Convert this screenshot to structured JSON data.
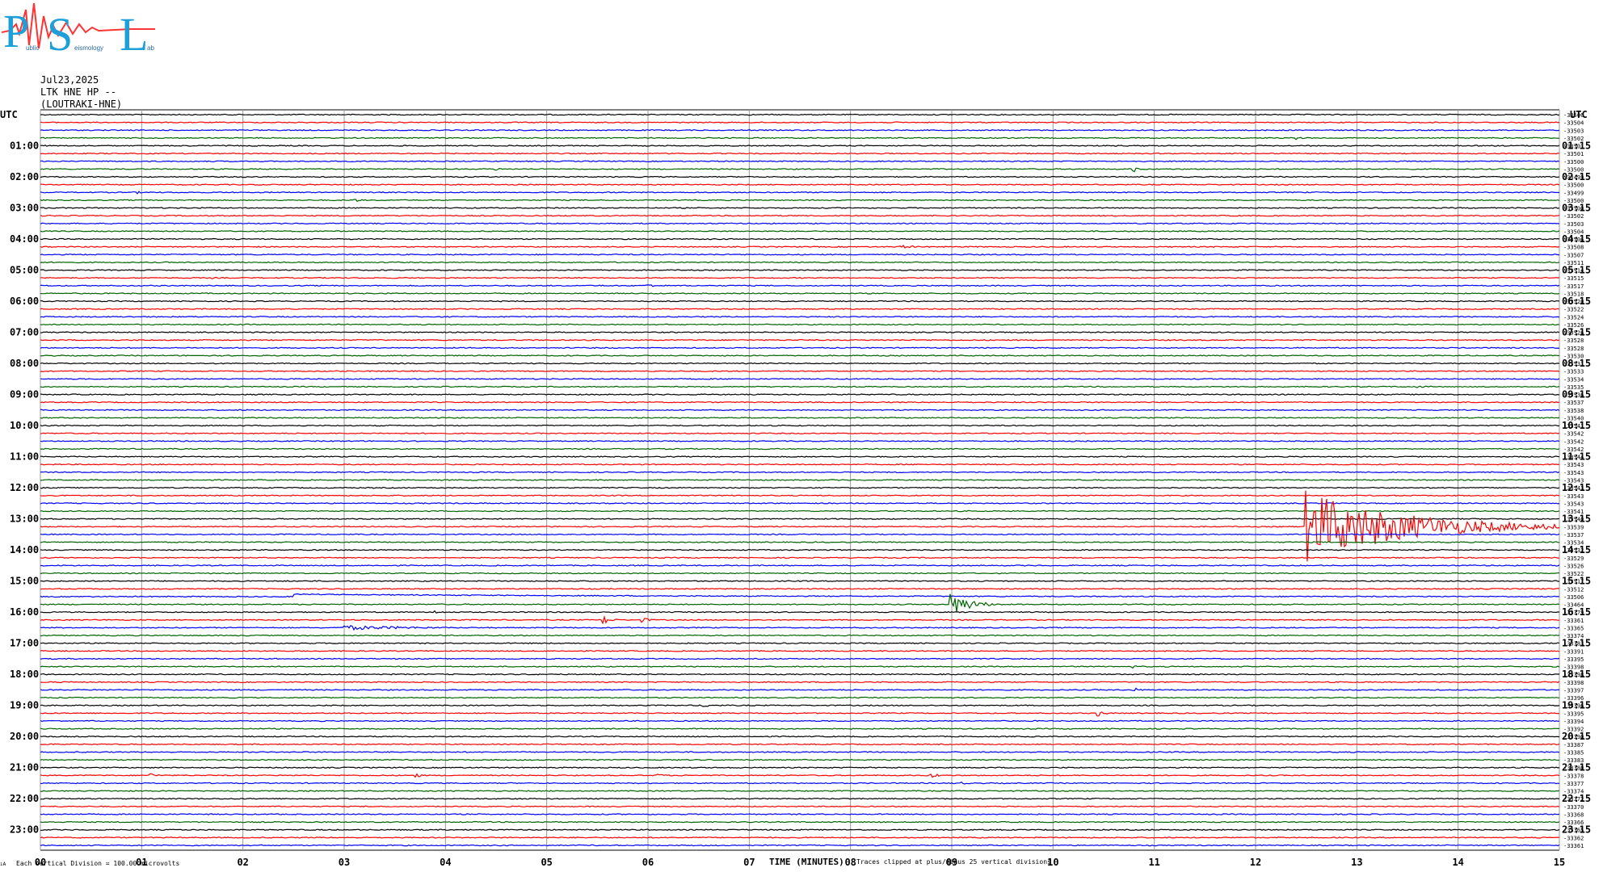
{
  "logo": {
    "letters": [
      "P",
      "S",
      "L"
    ],
    "words": [
      "ublic",
      "eismology",
      "ab"
    ],
    "colors": {
      "letters": "#1e9fd8",
      "wave": "#ff3333",
      "text": "#2a6aa0"
    }
  },
  "header": {
    "date": "Jul23,2025",
    "station": "LTK HNE HP --",
    "site": "(LOUTRAKI-HNE)"
  },
  "footer": {
    "scale_note": "Each Vertical Division =  100.00 microvolts",
    "clip_note": "Traces clipped at plus/minus 25 vertical divisions",
    "corner_mark": "ıA"
  },
  "chart_data": {
    "type": "line",
    "title": "",
    "xlabel": "TIME (MINUTES)",
    "ylabel": "",
    "xlim": [
      0,
      15
    ],
    "x_ticks": [
      "00",
      "01",
      "02",
      "03",
      "04",
      "05",
      "06",
      "07",
      "08",
      "09",
      "10",
      "11",
      "12",
      "13",
      "14",
      "15"
    ],
    "grid": true,
    "rows_per_hour": 4,
    "trace_colors": [
      "#000000",
      "#ff0000",
      "#0000ff",
      "#006400"
    ],
    "left_label_header": "UTC",
    "right_label_header": "UTC",
    "left_hour_labels": [
      "01:00",
      "02:00",
      "03:00",
      "04:00",
      "05:00",
      "06:00",
      "07:00",
      "08:00",
      "09:00",
      "10:00",
      "11:00",
      "12:00",
      "13:00",
      "14:00",
      "15:00",
      "16:00",
      "17:00",
      "18:00",
      "19:00",
      "20:00",
      "21:00",
      "22:00",
      "23:00"
    ],
    "right_hour_labels": [
      "01:15",
      "02:15",
      "03:15",
      "04:15",
      "05:15",
      "06:15",
      "07:15",
      "08:15",
      "09:15",
      "10:15",
      "11:15",
      "12:15",
      "13:15",
      "14:15",
      "15:15",
      "16:15",
      "17:15",
      "18:15",
      "19:15",
      "20:15",
      "21:15",
      "22:15",
      "23:15"
    ],
    "trace_offsets": [
      "-33506",
      "-33504",
      "-33503",
      "-33502",
      "-33501",
      "-33501",
      "-33500",
      "-33500",
      "-33499",
      "-33500",
      "-33499",
      "-33500",
      "-33500",
      "-33502",
      "-33503",
      "-33504",
      "-33506",
      "-33508",
      "-33507",
      "-33511",
      "-33514",
      "-33515",
      "-33517",
      "-33518",
      "-33520",
      "-33522",
      "-33524",
      "-33526",
      "-33526",
      "-33528",
      "-33528",
      "-33530",
      "-33531",
      "-33533",
      "-33534",
      "-33535",
      "-33536",
      "-33537",
      "-33538",
      "-33540",
      "-33541",
      "-33542",
      "-33542",
      "-33542",
      "-33544",
      "-33543",
      "-33543",
      "-33543",
      "-33543",
      "-33543",
      "-33543",
      "-33541",
      "-33540",
      "-33539",
      "-33537",
      "-33534",
      "-33532",
      "-33529",
      "-33526",
      "-33522",
      "-33517",
      "-33512",
      "-33506",
      "-33464",
      "-33379",
      "-33361",
      "-33365",
      "-33374",
      "-33383",
      "-33391",
      "-33395",
      "-33398",
      "-33398",
      "-33398",
      "-33397",
      "-33396",
      "-33396",
      "-33395",
      "-33394",
      "-33392",
      "-33390",
      "-33387",
      "-33385",
      "-33383",
      "-33380",
      "-33378",
      "-33377",
      "-33374",
      "-33372",
      "-33370",
      "-33368",
      "-33366",
      "-33365",
      "-33362",
      "-33361"
    ],
    "events": [
      {
        "row": 3,
        "minute": 12.4,
        "width_min": 0.2,
        "amp": 2
      },
      {
        "row": 7,
        "minute": 4.5,
        "width_min": 0.12,
        "amp": 2
      },
      {
        "row": 7,
        "minute": 10.8,
        "width_min": 0.1,
        "amp": 4
      },
      {
        "row": 9,
        "minute": 13.4,
        "width_min": 0.05,
        "amp": 2
      },
      {
        "row": 10,
        "minute": 0.95,
        "width_min": 0.1,
        "amp": 2
      },
      {
        "row": 11,
        "minute": 3.1,
        "width_min": 0.25,
        "amp": 2
      },
      {
        "row": 17,
        "minute": 8.5,
        "width_min": 0.5,
        "amp": 2
      },
      {
        "row": 21,
        "minute": 1.7,
        "width_min": 0.15,
        "amp": 1
      },
      {
        "row": 22,
        "minute": 5.5,
        "width_min": 0.6,
        "amp": 1
      },
      {
        "row": 22,
        "minute": 6.0,
        "width_min": 0.3,
        "amp": 2
      },
      {
        "row": 35,
        "minute": 13.6,
        "width_min": 0.2,
        "amp": 2
      },
      {
        "row": 53,
        "minute": 12.5,
        "width_min": 2.6,
        "amp": 45
      },
      {
        "row": 63,
        "minute": 9.0,
        "width_min": 0.5,
        "amp": 14
      },
      {
        "row": 64,
        "minute": 3.9,
        "width_min": 0.15,
        "amp": 3
      },
      {
        "row": 65,
        "minute": 5.55,
        "width_min": 0.15,
        "amp": 8
      },
      {
        "row": 65,
        "minute": 5.95,
        "width_min": 0.2,
        "amp": 3
      },
      {
        "row": 66,
        "minute": 3.0,
        "width_min": 2.0,
        "amp": 3
      },
      {
        "row": 71,
        "minute": 10.8,
        "width_min": 0.2,
        "amp": 2
      },
      {
        "row": 74,
        "minute": 10.8,
        "width_min": 0.15,
        "amp": 3
      },
      {
        "row": 76,
        "minute": 6.55,
        "width_min": 0.15,
        "amp": 3
      },
      {
        "row": 77,
        "minute": 10.45,
        "width_min": 0.15,
        "amp": 4
      },
      {
        "row": 78,
        "minute": 0.5,
        "width_min": 0.1,
        "amp": 1
      },
      {
        "row": 79,
        "minute": 8.9,
        "width_min": 0.1,
        "amp": 1
      },
      {
        "row": 85,
        "minute": 1.1,
        "width_min": 0.15,
        "amp": 3
      },
      {
        "row": 85,
        "minute": 3.7,
        "width_min": 0.15,
        "amp": 3
      },
      {
        "row": 85,
        "minute": 6.1,
        "width_min": 0.15,
        "amp": 3
      },
      {
        "row": 85,
        "minute": 8.8,
        "width_min": 0.15,
        "amp": 4
      },
      {
        "row": 86,
        "minute": 9.1,
        "width_min": 0.1,
        "amp": 2
      }
    ],
    "baseline_drift": [
      {
        "row": 62,
        "from_minute": 2.5,
        "to_minute": 15,
        "amp": 3
      }
    ]
  }
}
